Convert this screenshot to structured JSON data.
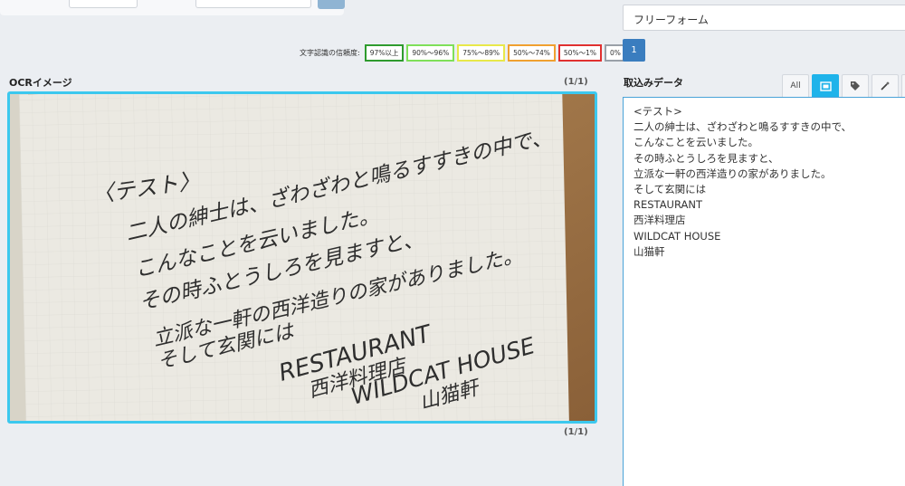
{
  "legend": {
    "label": "文字認識の信頼度:",
    "items": [
      {
        "text": "97%以上",
        "color": "#2e9b2e"
      },
      {
        "text": "90%〜96%",
        "color": "#7fe05a"
      },
      {
        "text": "75%〜89%",
        "color": "#e8e84a"
      },
      {
        "text": "50%〜74%",
        "color": "#f0a030"
      },
      {
        "text": "50%〜1%",
        "color": "#e03030"
      },
      {
        "text": "0%",
        "color": "#9aa0a8"
      }
    ]
  },
  "ocr": {
    "title": "OCRイメージ",
    "page_count": "(1/1)",
    "handwriting": [
      "〈テスト〉",
      "二人の紳士は、ざわざわと鳴るすすきの中で、",
      "こんなことを云いました。",
      "その時ふとうしろを見ますと、",
      "立派な一軒の西洋造りの家がありました。",
      "そして玄関には",
      "RESTAURANT",
      "西洋料理店",
      "WILDCAT HOUSE",
      "山猫軒"
    ]
  },
  "mode_select": {
    "value": "フリーフォーム"
  },
  "pagination": {
    "current": "1"
  },
  "extracted": {
    "title": "取込みデータ",
    "tabs": [
      {
        "label": "All",
        "icon": "",
        "active": false
      },
      {
        "label": "",
        "icon": "region-icon",
        "active": true
      },
      {
        "label": "",
        "icon": "tag-icon",
        "active": false
      },
      {
        "label": "",
        "icon": "magic-wand-icon",
        "active": false
      },
      {
        "label": "",
        "icon": "copy-icon",
        "active": false
      }
    ],
    "lines": [
      "<テスト>",
      "二人の紳士は、ざわざわと鳴るすすきの中で、",
      "こんなことを云いました。",
      "その時ふとうしろを見ますと、",
      "立派な一軒の西洋造りの家がありました。",
      "そして玄関には",
      "RESTAURANT",
      "西洋料理店",
      "WILDCAT HOUSE",
      "山猫軒"
    ]
  },
  "colors": {
    "accent": "#1fb3ea",
    "frame": "#3cc8ee",
    "page_button": "#3a7dbf"
  }
}
